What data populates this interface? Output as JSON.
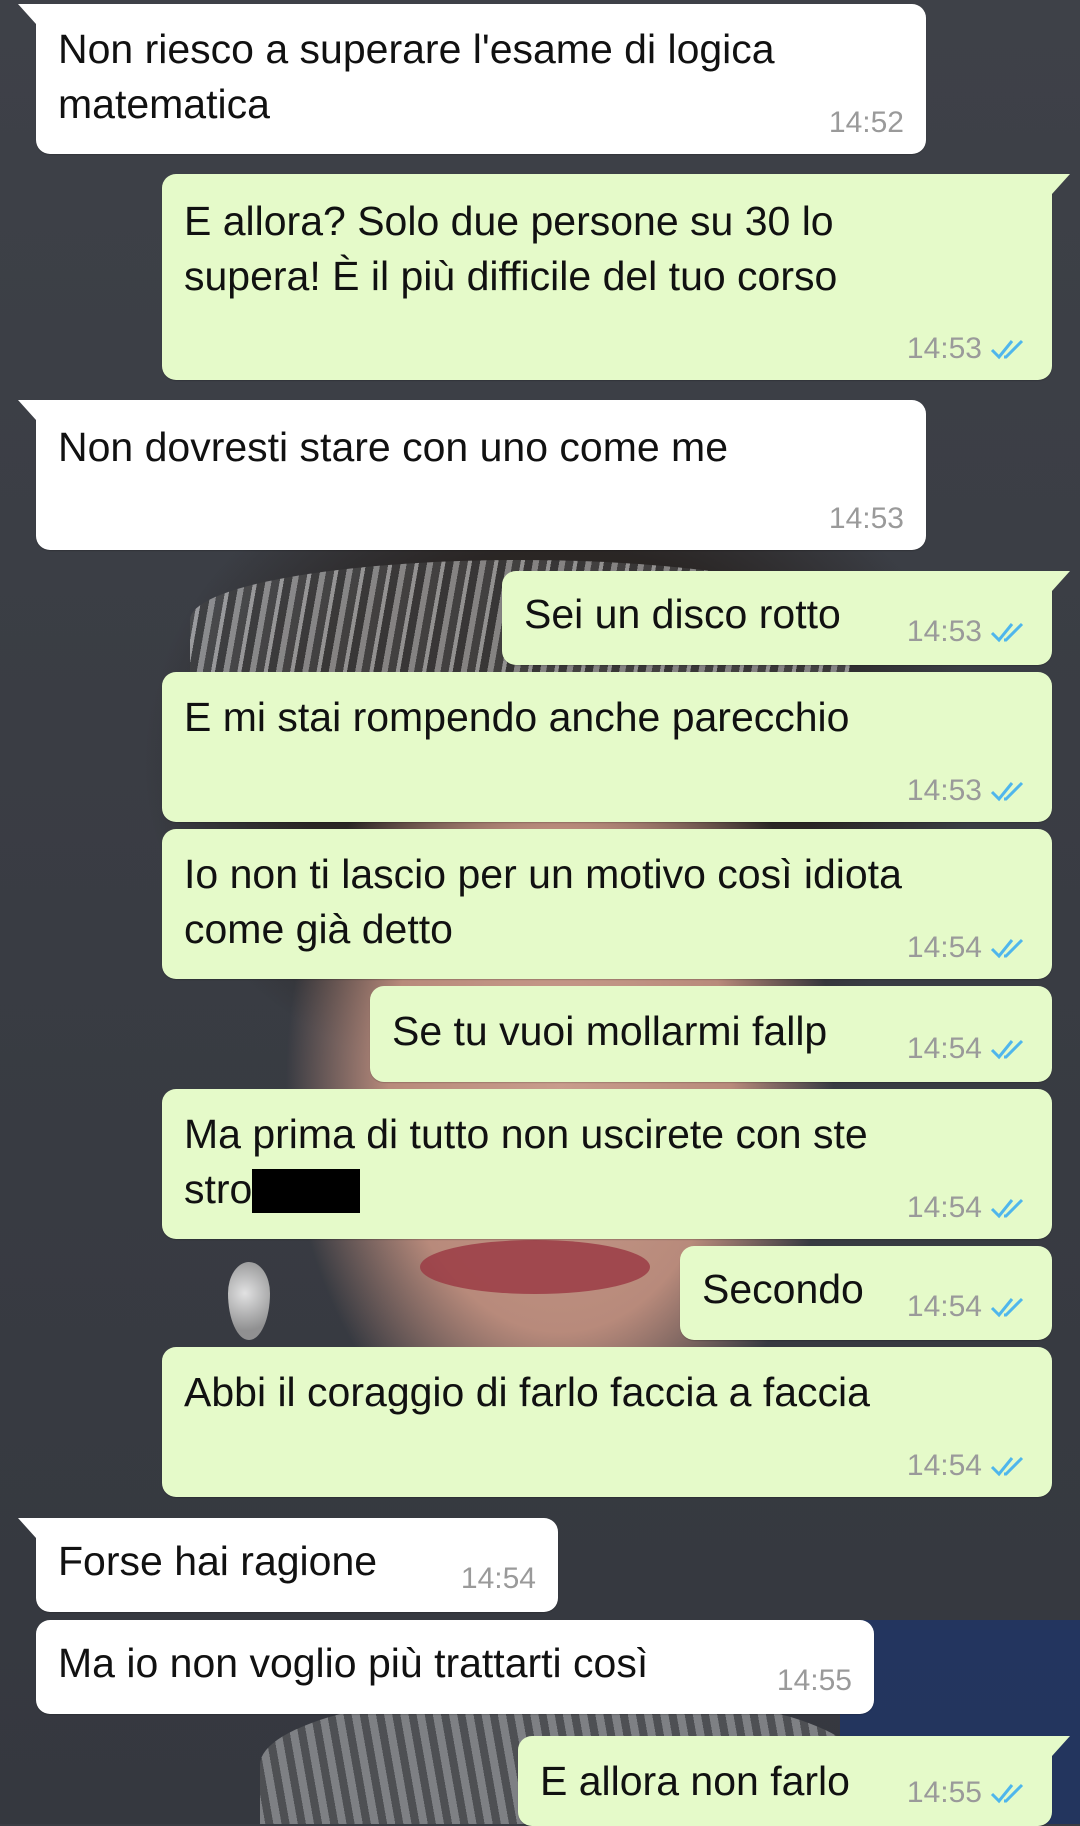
{
  "colors": {
    "incoming_bubble": "#ffffff",
    "outgoing_bubble": "#e5fac9",
    "timestamp": "#9a9a9a",
    "read_ticks": "#4fb6ec",
    "redaction": "#000000"
  },
  "icons": {
    "read_receipt": "double-check-icon"
  },
  "messages": [
    {
      "direction": "incoming",
      "text": "Non riesco a superare l'esame di logica\nmatematica",
      "time": "14:52"
    },
    {
      "direction": "outgoing",
      "text": "E allora? Solo due persone su 30 lo\nsupera! È il più difficile del tuo corso",
      "time": "14:53",
      "read": true
    },
    {
      "direction": "incoming",
      "text": "Non dovresti stare con uno come me",
      "time": "14:53"
    },
    {
      "direction": "outgoing",
      "text": "Sei un disco rotto",
      "time": "14:53",
      "read": true
    },
    {
      "direction": "outgoing",
      "text": "E mi stai rompendo anche parecchio",
      "time": "14:53",
      "read": true
    },
    {
      "direction": "outgoing",
      "text": "Io non ti lascio per un motivo così idiota\ncome già detto",
      "time": "14:54",
      "read": true
    },
    {
      "direction": "outgoing",
      "text": "Se tu vuoi mollarmi fallp",
      "time": "14:54",
      "read": true
    },
    {
      "direction": "outgoing",
      "text": "Ma prima di tutto non uscirete con ste",
      "text_line2_visible": "stro",
      "redacted": true,
      "time": "14:54",
      "read": true
    },
    {
      "direction": "outgoing",
      "text": "Secondo",
      "time": "14:54",
      "read": true
    },
    {
      "direction": "outgoing",
      "text": "Abbi il coraggio di farlo faccia a faccia",
      "time": "14:54",
      "read": true
    },
    {
      "direction": "incoming",
      "text": "Forse hai ragione",
      "time": "14:54"
    },
    {
      "direction": "incoming",
      "text": "Ma io non voglio più trattarti così",
      "time": "14:55"
    },
    {
      "direction": "outgoing",
      "text": "E allora non farlo",
      "time": "14:55",
      "read": true
    }
  ]
}
